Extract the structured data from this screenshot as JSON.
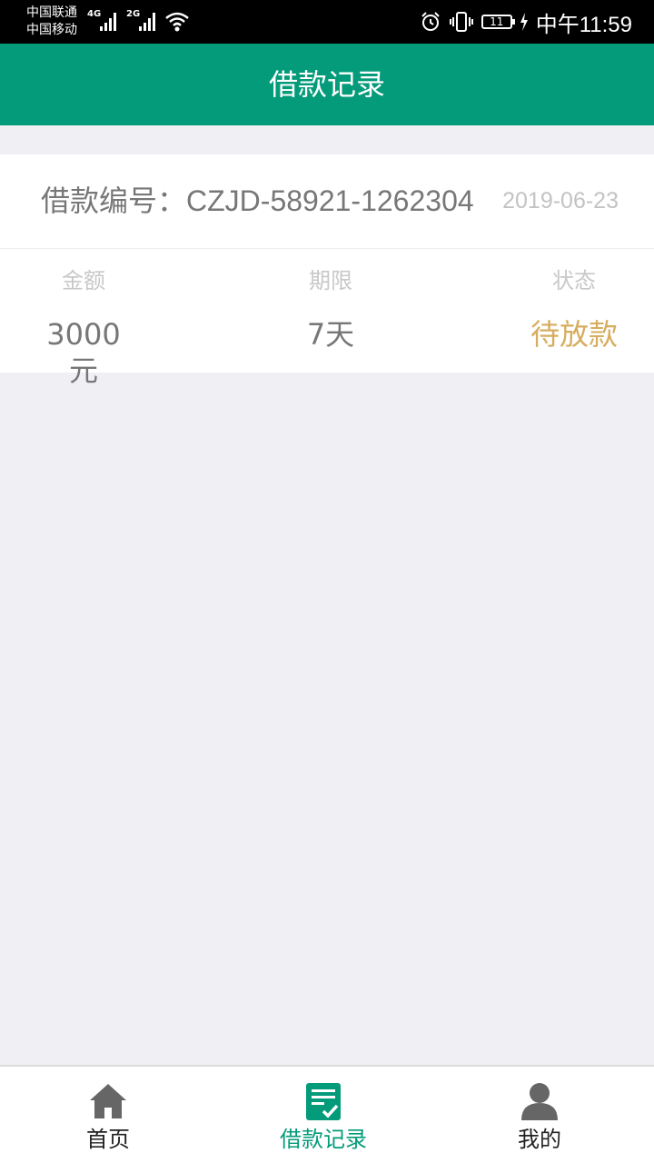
{
  "status_bar": {
    "carrier1": "中国联通",
    "carrier2": "中国移动",
    "network1": "4G",
    "network2": "2G",
    "battery": "11",
    "time": "中午11:59",
    "icons": [
      "signal-icon",
      "wifi-icon",
      "alarm-icon",
      "vibrate-icon",
      "battery-icon",
      "charging-icon"
    ]
  },
  "header": {
    "title": "借款记录",
    "background": "#049b7a"
  },
  "record": {
    "loan_number_label": "借款编号：",
    "loan_number": "CZJD-58921-1262304",
    "date": "2019-06-23",
    "amount_label": "金额",
    "amount": "3000元",
    "term_label": "期限",
    "term": "7天",
    "status_label": "状态",
    "status": "待放款",
    "status_color": "#d6ad5e"
  },
  "tabbar": {
    "items": [
      {
        "label": "首页",
        "icon": "home-icon",
        "active": false
      },
      {
        "label": "借款记录",
        "icon": "record-icon",
        "active": true
      },
      {
        "label": "我的",
        "icon": "user-icon",
        "active": false
      }
    ],
    "active_color": "#049b7a"
  }
}
